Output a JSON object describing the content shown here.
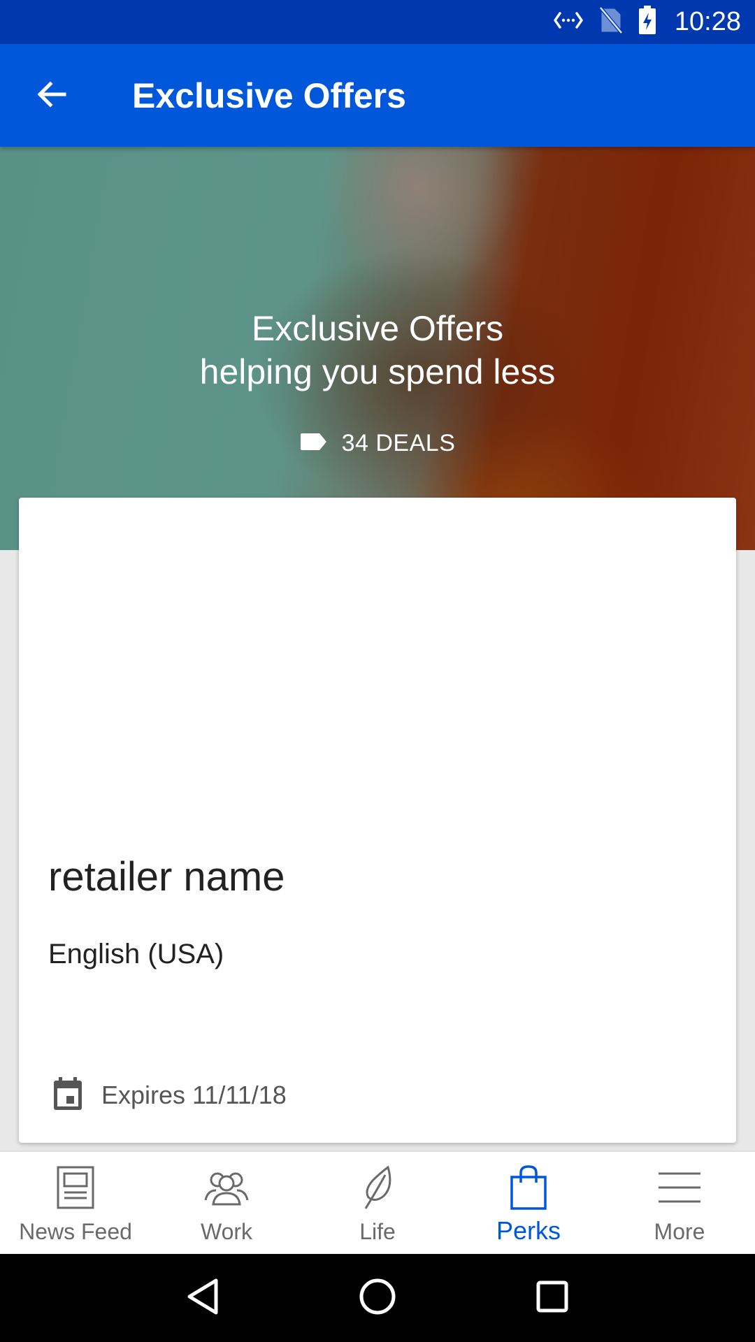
{
  "status_bar": {
    "time": "10:28",
    "icons": [
      "data-transfer-icon",
      "no-sim-icon",
      "battery-charging-icon"
    ]
  },
  "app_bar": {
    "back_icon": "arrow-left-icon",
    "title": "Exclusive Offers"
  },
  "hero": {
    "line1": "Exclusive Offers",
    "line2": "helping you spend less",
    "deals_icon": "tag-icon",
    "deals_label": "34 DEALS"
  },
  "card": {
    "retailer_name": "retailer name",
    "locale": "English (USA)",
    "expiry_icon": "calendar-icon",
    "expiry_text": "Expires 11/11/18"
  },
  "bottom_nav": {
    "active_color": "#0057d9",
    "items": [
      {
        "label": "News Feed",
        "icon": "newspaper-icon",
        "active": false
      },
      {
        "label": "Work",
        "icon": "people-icon",
        "active": false
      },
      {
        "label": "Life",
        "icon": "leaf-icon",
        "active": false
      },
      {
        "label": "Perks",
        "icon": "shopping-bag-icon",
        "active": true
      },
      {
        "label": "More",
        "icon": "menu-icon",
        "active": false
      }
    ]
  },
  "system_nav": {
    "icons": [
      "back-triangle-icon",
      "home-circle-icon",
      "recents-square-icon"
    ]
  },
  "colors": {
    "status_bar": "#0038b0",
    "app_bar": "#0057d9",
    "background": "#e8e8e8"
  }
}
